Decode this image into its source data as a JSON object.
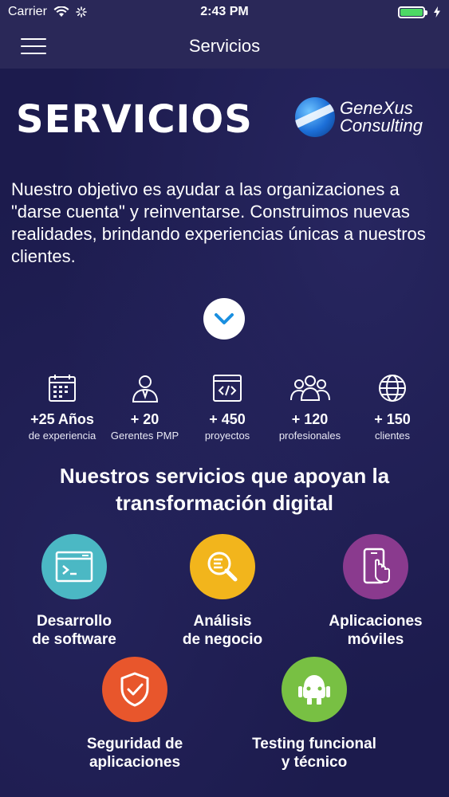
{
  "status_bar": {
    "carrier": "Carrier",
    "time": "2:43 PM"
  },
  "nav": {
    "title": "Servicios"
  },
  "hero": {
    "title": "SERVICIOS",
    "logo_line1": "GeneXus",
    "logo_line2": "Consulting",
    "intro": "Nuestro objetivo es ayudar a las organizaciones a \"darse cuenta\" y reinventarse. Construimos nuevas realidades, brindando experiencias únicas a nuestros clientes."
  },
  "stats": [
    {
      "icon": "calendar-icon",
      "value": "+25 Años",
      "label": "de experiencia"
    },
    {
      "icon": "manager-icon",
      "value": "+ 20",
      "label": "Gerentes PMP"
    },
    {
      "icon": "code-window-icon",
      "value": "+ 450",
      "label": "proyectos"
    },
    {
      "icon": "team-icon",
      "value": "+ 120",
      "label": "profesionales"
    },
    {
      "icon": "globe-icon",
      "value": "+ 150",
      "label": "clientes"
    }
  ],
  "services": {
    "heading_line1": "Nuestros servicios que apoyan la",
    "heading_line2": "transformación digital",
    "items": [
      {
        "line1": "Desarrollo",
        "line2": "de software",
        "color": "#4bb8c4",
        "icon": "terminal-icon"
      },
      {
        "line1": "Análisis",
        "line2": "de negocio",
        "color": "#f2b51c",
        "icon": "magnifier-icon"
      },
      {
        "line1": "Aplicaciones",
        "line2": "móviles",
        "color": "#8a3a8e",
        "icon": "mobile-touch-icon"
      },
      {
        "line1": "Seguridad de",
        "line2": "aplicaciones",
        "color": "#e8562c",
        "icon": "shield-check-icon"
      },
      {
        "line1": "Testing funcional",
        "line2": "y técnico",
        "color": "#78c043",
        "icon": "robot-icon"
      }
    ]
  }
}
